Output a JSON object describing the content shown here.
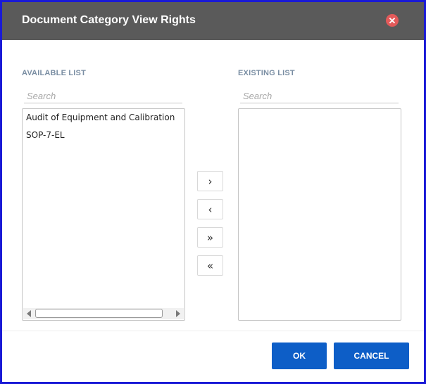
{
  "dialog": {
    "title": "Document Category View Rights",
    "close_icon": "close-icon"
  },
  "available": {
    "label": "AVAILABLE LIST",
    "search_placeholder": "Search",
    "items": [
      "Audit of Equipment and Calibration",
      "SOP-7-EL"
    ]
  },
  "existing": {
    "label": "EXISTING LIST",
    "search_placeholder": "Search",
    "items": []
  },
  "transfer_buttons": {
    "move_right": "›",
    "move_left": "‹",
    "move_all_right": "»",
    "move_all_left": "«"
  },
  "footer": {
    "ok_label": "OK",
    "cancel_label": "CANCEL"
  },
  "colors": {
    "title_bar": "#5a5a5a",
    "close_button": "#e35a5a",
    "primary_button": "#0d5ec7",
    "label_text": "#7a8ea3",
    "window_border": "#1a1ad6"
  }
}
